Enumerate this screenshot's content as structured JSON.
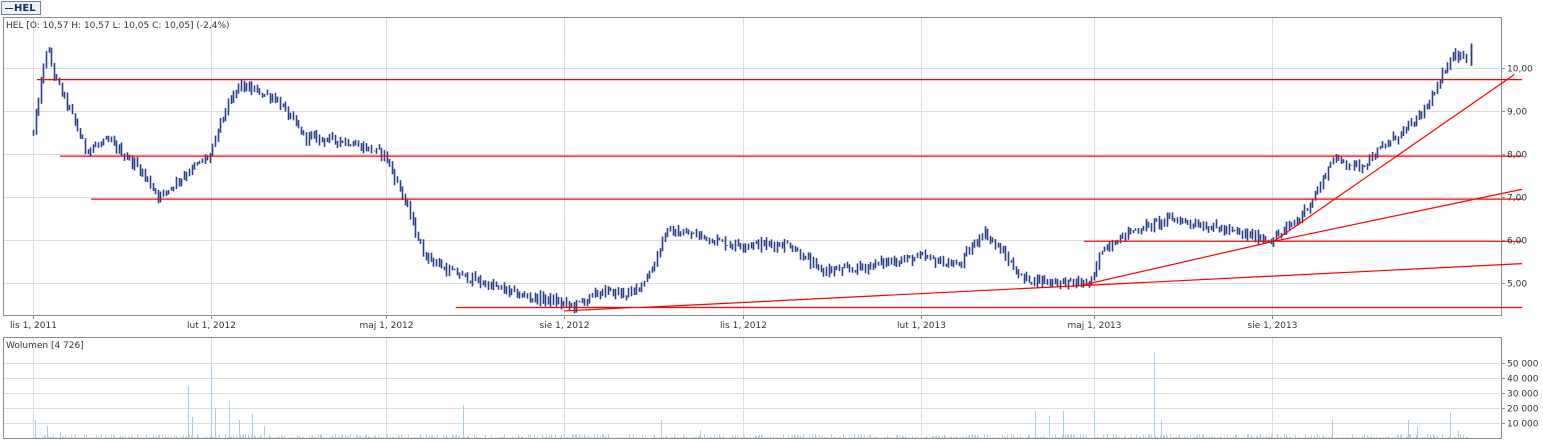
{
  "tab": {
    "label": "HEL"
  },
  "price_legend": "HEL [O: 10,57  H: 10,57  L: 10,05  C: 10,05] (-2,4%)",
  "volume_legend": "Wolumen [4 726]",
  "colors": {
    "candle": "#2b3f8c",
    "support_lines": "#ff0000",
    "volume": "#aacde6",
    "grid": "#dcdcdc"
  },
  "chart_data": [
    {
      "type": "ohlc",
      "title": "HEL",
      "ylim": [
        4.25,
        11.1
      ],
      "y_ticks": [
        5,
        6,
        7,
        8,
        9,
        10
      ],
      "y_tick_labels": [
        "5,00",
        "6,00",
        "7,00",
        "8,00",
        "9,00",
        "10,00"
      ],
      "x_tick_labels": [
        "lis 1, 2011",
        "lut 1, 2012",
        "maj 1, 2012",
        "sie 1, 2012",
        "lis 1, 2012",
        "lut 1, 2013",
        "maj 1, 2013",
        "sie 1, 2013"
      ],
      "last_bar": {
        "open": 10.57,
        "high": 10.57,
        "low": 10.05,
        "close": 10.05,
        "change_pct": -2.4
      },
      "price_path": [
        [
          "2011-11-01",
          8.5
        ],
        [
          "2011-11-08",
          10.5
        ],
        [
          "2011-11-12",
          9.8
        ],
        [
          "2011-11-20",
          9.0
        ],
        [
          "2011-11-28",
          8.1
        ],
        [
          "2011-12-10",
          8.3
        ],
        [
          "2011-12-25",
          7.7
        ],
        [
          "2012-01-05",
          7.0
        ],
        [
          "2012-01-20",
          7.6
        ],
        [
          "2012-02-01",
          8.0
        ],
        [
          "2012-02-05",
          8.7
        ],
        [
          "2012-02-15",
          9.6
        ],
        [
          "2012-03-05",
          9.3
        ],
        [
          "2012-03-20",
          8.4
        ],
        [
          "2012-04-10",
          8.3
        ],
        [
          "2012-04-30",
          8.0
        ],
        [
          "2012-05-10",
          7.0
        ],
        [
          "2012-05-20",
          5.7
        ],
        [
          "2012-06-01",
          5.3
        ],
        [
          "2012-06-20",
          5.0
        ],
        [
          "2012-07-10",
          4.7
        ],
        [
          "2012-07-25",
          4.6
        ],
        [
          "2012-08-05",
          4.45
        ],
        [
          "2012-08-20",
          4.8
        ],
        [
          "2012-09-05",
          4.75
        ],
        [
          "2012-09-15",
          5.3
        ],
        [
          "2012-09-22",
          6.2
        ],
        [
          "2012-10-10",
          6.1
        ],
        [
          "2012-10-25",
          5.9
        ],
        [
          "2012-11-10",
          5.9
        ],
        [
          "2012-11-25",
          5.9
        ],
        [
          "2012-12-10",
          5.3
        ],
        [
          "2012-12-25",
          5.3
        ],
        [
          "2013-01-15",
          5.5
        ],
        [
          "2013-02-01",
          5.6
        ],
        [
          "2013-02-20",
          5.4
        ],
        [
          "2013-03-05",
          6.2
        ],
        [
          "2013-03-15",
          5.7
        ],
        [
          "2013-03-25",
          5.1
        ],
        [
          "2013-04-20",
          5.0
        ],
        [
          "2013-04-30",
          5.0
        ],
        [
          "2013-05-05",
          5.8
        ],
        [
          "2013-05-20",
          6.2
        ],
        [
          "2013-06-10",
          6.5
        ],
        [
          "2013-07-01",
          6.3
        ],
        [
          "2013-07-20",
          6.1
        ],
        [
          "2013-08-01",
          6.0
        ],
        [
          "2013-08-15",
          6.5
        ],
        [
          "2013-08-25",
          7.2
        ],
        [
          "2013-09-01",
          7.9
        ],
        [
          "2013-09-15",
          7.7
        ],
        [
          "2013-10-01",
          8.3
        ],
        [
          "2013-10-15",
          8.8
        ],
        [
          "2013-10-25",
          9.5
        ],
        [
          "2013-11-01",
          10.3
        ],
        [
          "2013-11-10",
          10.3
        ]
      ],
      "horizontal_lines": [
        {
          "price": 9.73,
          "from": "2011-11-03",
          "to": "2013-12-08"
        },
        {
          "price": 7.95,
          "from": "2011-11-15",
          "to": "2013-12-08"
        },
        {
          "price": 6.95,
          "from": "2011-12-01",
          "to": "2013-12-08"
        },
        {
          "price": 5.97,
          "from": "2013-04-26",
          "to": "2013-12-08"
        },
        {
          "price": 4.43,
          "from": "2012-06-06",
          "to": "2013-12-08"
        }
      ],
      "trend_lines": [
        {
          "from": [
            "2012-08-01",
            4.35
          ],
          "to": [
            "2012-09-05",
            4.43
          ]
        },
        {
          "from": [
            "2012-09-10",
            4.43
          ],
          "to": [
            "2013-12-08",
            5.45
          ]
        },
        {
          "from": [
            "2013-04-25",
            4.95
          ],
          "to": [
            "2013-08-02",
            5.97
          ]
        },
        {
          "from": [
            "2013-08-02",
            5.97
          ],
          "to": [
            "2013-12-08",
            7.18
          ]
        },
        {
          "from": [
            "2013-08-02",
            5.97
          ],
          "to": [
            "2013-12-04",
            9.85
          ]
        }
      ]
    },
    {
      "type": "bar",
      "title": "Wolumen",
      "ylim": [
        0,
        60000
      ],
      "y_ticks": [
        10000,
        20000,
        30000,
        40000,
        50000
      ],
      "y_tick_labels": [
        "10 000",
        "20 000",
        "30 000",
        "40 000",
        "50 000"
      ],
      "volume_spikes": [
        [
          "2011-11-02",
          12000
        ],
        [
          "2011-11-08",
          8000
        ],
        [
          "2011-11-15",
          4000
        ],
        [
          "2012-01-20",
          35000
        ],
        [
          "2012-01-22",
          14000
        ],
        [
          "2012-02-01",
          48000
        ],
        [
          "2012-02-03",
          20000
        ],
        [
          "2012-02-10",
          25000
        ],
        [
          "2012-02-15",
          12000
        ],
        [
          "2012-02-22",
          16000
        ],
        [
          "2012-02-28",
          8000
        ],
        [
          "2012-06-10",
          22000
        ],
        [
          "2012-09-20",
          12000
        ],
        [
          "2012-10-10",
          5000
        ],
        [
          "2013-04-01",
          18000
        ],
        [
          "2013-04-08",
          15000
        ],
        [
          "2013-04-15",
          18000
        ],
        [
          "2013-05-01",
          18000
        ],
        [
          "2013-06-01",
          57000
        ],
        [
          "2013-06-05",
          12000
        ],
        [
          "2013-09-01",
          12000
        ],
        [
          "2013-10-10",
          12000
        ],
        [
          "2013-10-15",
          8000
        ],
        [
          "2013-11-01",
          17000
        ],
        [
          "2013-11-05",
          4726
        ]
      ]
    }
  ]
}
